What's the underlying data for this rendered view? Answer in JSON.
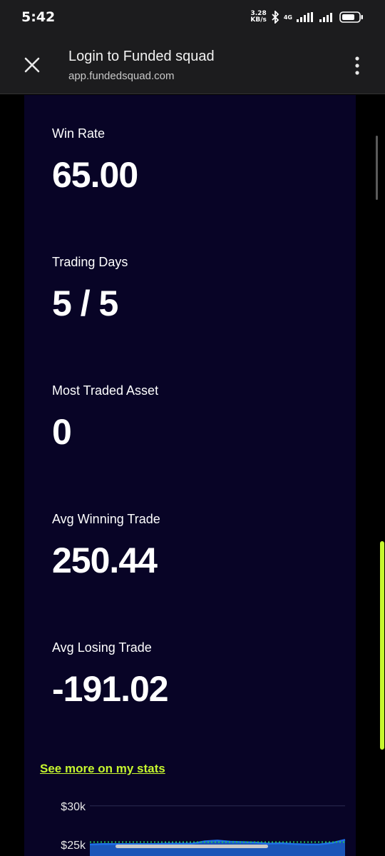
{
  "status_bar": {
    "time": "5:42",
    "speed_value": "3.28",
    "speed_unit": "KB/s",
    "network": "4G"
  },
  "browser": {
    "title": "Login to Funded squad",
    "url": "app.fundedsquad.com"
  },
  "stats": [
    {
      "label": "Win Rate",
      "value": "65.00"
    },
    {
      "label": "Trading Days",
      "value": "5 / 5"
    },
    {
      "label": "Most Traded Asset",
      "value": "0"
    },
    {
      "label": "Avg Winning Trade",
      "value": "250.44"
    },
    {
      "label": "Avg Losing Trade",
      "value": "-191.02"
    }
  ],
  "links": {
    "see_more": "See more on my stats"
  },
  "chart_data": {
    "type": "area",
    "y_ticks": [
      "$30k",
      "$25k"
    ],
    "target_line": 25300,
    "ylim": [
      23500,
      31000
    ],
    "x": [
      0,
      1,
      2,
      3,
      4,
      5,
      6,
      7,
      8,
      9,
      10,
      11,
      12,
      13,
      14,
      15,
      16,
      17,
      18,
      19,
      20
    ],
    "values": [
      25000,
      25050,
      25050,
      25050,
      25050,
      25050,
      25100,
      25100,
      25100,
      25400,
      25500,
      25350,
      25300,
      25250,
      25100,
      25150,
      25050,
      25000,
      25000,
      25200,
      25600
    ],
    "colors": {
      "line": "#1e6fe8",
      "fill": "#1a55b8",
      "target": "#22c55e",
      "grid": "#2b2b50"
    }
  },
  "colors": {
    "accent": "#c6f62f",
    "panel": "#080426"
  }
}
